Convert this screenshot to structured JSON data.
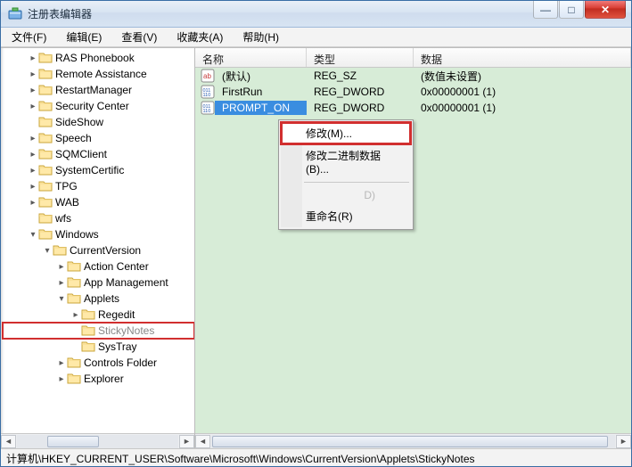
{
  "window": {
    "title": "注册表编辑器"
  },
  "titlebar_buttons": {
    "min": "—",
    "max": "□",
    "close": "✕"
  },
  "menu": {
    "file": "文件(F)",
    "edit": "编辑(E)",
    "view": "查看(V)",
    "favorites": "收藏夹(A)",
    "help": "帮助(H)"
  },
  "tree": {
    "items": [
      {
        "label": "RAS Phonebook",
        "depth": 2,
        "expander": "collapsed"
      },
      {
        "label": "Remote Assistance",
        "depth": 2,
        "expander": "collapsed"
      },
      {
        "label": "RestartManager",
        "depth": 2,
        "expander": "collapsed"
      },
      {
        "label": "Security Center",
        "depth": 2,
        "expander": "collapsed"
      },
      {
        "label": "SideShow",
        "depth": 2,
        "expander": "none"
      },
      {
        "label": "Speech",
        "depth": 2,
        "expander": "collapsed"
      },
      {
        "label": "SQMClient",
        "depth": 2,
        "expander": "collapsed"
      },
      {
        "label": "SystemCertific",
        "depth": 2,
        "expander": "collapsed"
      },
      {
        "label": "TPG",
        "depth": 2,
        "expander": "collapsed"
      },
      {
        "label": "WAB",
        "depth": 2,
        "expander": "collapsed"
      },
      {
        "label": "wfs",
        "depth": 2,
        "expander": "none"
      },
      {
        "label": "Windows",
        "depth": 2,
        "expander": "expanded"
      },
      {
        "label": "CurrentVersion",
        "depth": 3,
        "expander": "expanded"
      },
      {
        "label": "Action Center",
        "depth": 4,
        "expander": "collapsed"
      },
      {
        "label": "App Management",
        "depth": 4,
        "expander": "collapsed"
      },
      {
        "label": "Applets",
        "depth": 4,
        "expander": "expanded"
      },
      {
        "label": "Regedit",
        "depth": 5,
        "expander": "collapsed"
      },
      {
        "label": "StickyNotes",
        "depth": 5,
        "expander": "none",
        "selected": true,
        "highlight": true
      },
      {
        "label": "SysTray",
        "depth": 5,
        "expander": "none"
      },
      {
        "label": "Controls Folder",
        "depth": 4,
        "expander": "collapsed"
      },
      {
        "label": "Explorer",
        "depth": 4,
        "expander": "collapsed"
      }
    ]
  },
  "columns": {
    "name": "名称",
    "type": "类型",
    "data": "数据"
  },
  "values": [
    {
      "icon": "sz",
      "name": "(默认)",
      "type": "REG_SZ",
      "data": "(数值未设置)"
    },
    {
      "icon": "dw",
      "name": "FirstRun",
      "type": "REG_DWORD",
      "data": "0x00000001 (1)"
    },
    {
      "icon": "dw",
      "name": "PROMPT_ON",
      "type": "REG_DWORD",
      "data": "0x00000001 (1)",
      "selected": true
    }
  ],
  "context_menu": {
    "modify": "修改(M)...",
    "modify_binary": "修改二进制数据(B)...",
    "d_item": "D)",
    "rename": "重命名(R)"
  },
  "statusbar": "计算机\\HKEY_CURRENT_USER\\Software\\Microsoft\\Windows\\CurrentVersion\\Applets\\StickyNotes",
  "scroll": {
    "left": "◄",
    "right": "►"
  }
}
